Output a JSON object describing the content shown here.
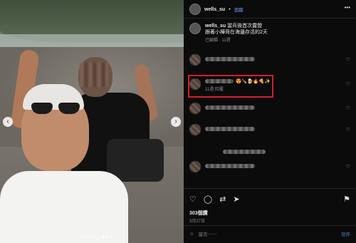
{
  "header": {
    "username": "wells_su",
    "follow_label": "追蹤",
    "more_icon": "ellipsis-icon"
  },
  "caption": {
    "username": "wells_su",
    "line1": "當兵後首次露營",
    "line2": "跟著小樺哥在海邊存活的2天",
    "edited": "已編輯",
    "time": "11週"
  },
  "comments": [
    {
      "likes_icon": "heart-icon"
    },
    {
      "emoji": "😍🍾🍺🔥🍕✨",
      "time": "11週",
      "reply": "回覆"
    },
    {},
    {},
    {},
    {}
  ],
  "actions": {
    "like": "heart-icon",
    "comment": "comment-icon",
    "share": "share-icon",
    "save": "bookmark-icon"
  },
  "likes": "303個讚",
  "date": "3月27日",
  "add_comment": {
    "placeholder": "留言⋯⋯",
    "post_label": "發佈"
  }
}
